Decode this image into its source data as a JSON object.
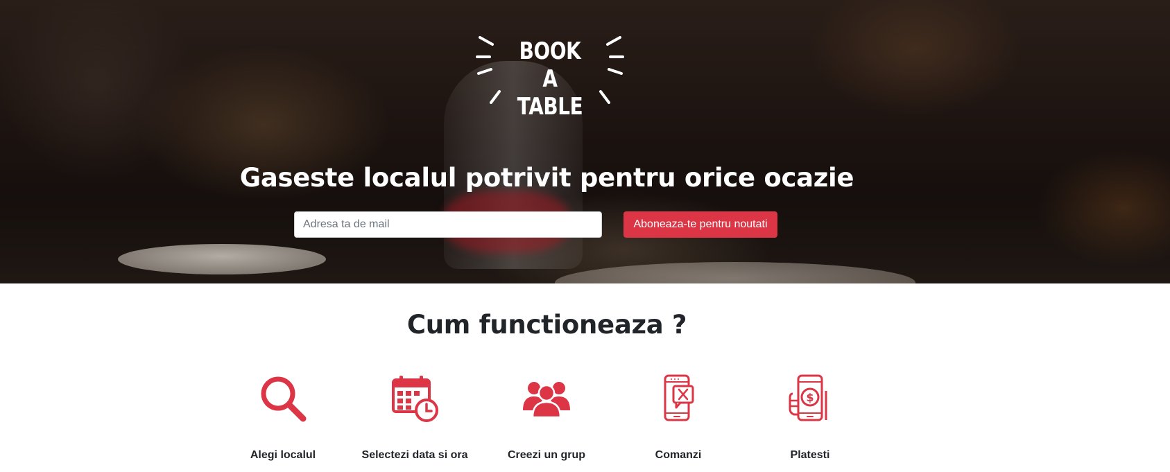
{
  "hero": {
    "logo_text": "BOOK A TABLE",
    "headline": "Gaseste localul potrivit pentru orice ocazie",
    "email_placeholder": "Adresa ta de mail",
    "subscribe_label": "Aboneaza-te pentru noutati"
  },
  "how_it_works": {
    "title": "Cum functioneaza ?",
    "steps": [
      {
        "label": "Alegi localul",
        "icon": "search-icon"
      },
      {
        "label": "Selectezi data si ora",
        "icon": "calendar-clock-icon"
      },
      {
        "label": "Creezi un grup",
        "icon": "group-icon"
      },
      {
        "label": "Comanzi",
        "icon": "phone-order-icon"
      },
      {
        "label": "Platesti",
        "icon": "phone-payment-icon"
      }
    ]
  },
  "colors": {
    "accent": "#dc3545",
    "text": "#212529",
    "background": "#ffffff"
  }
}
